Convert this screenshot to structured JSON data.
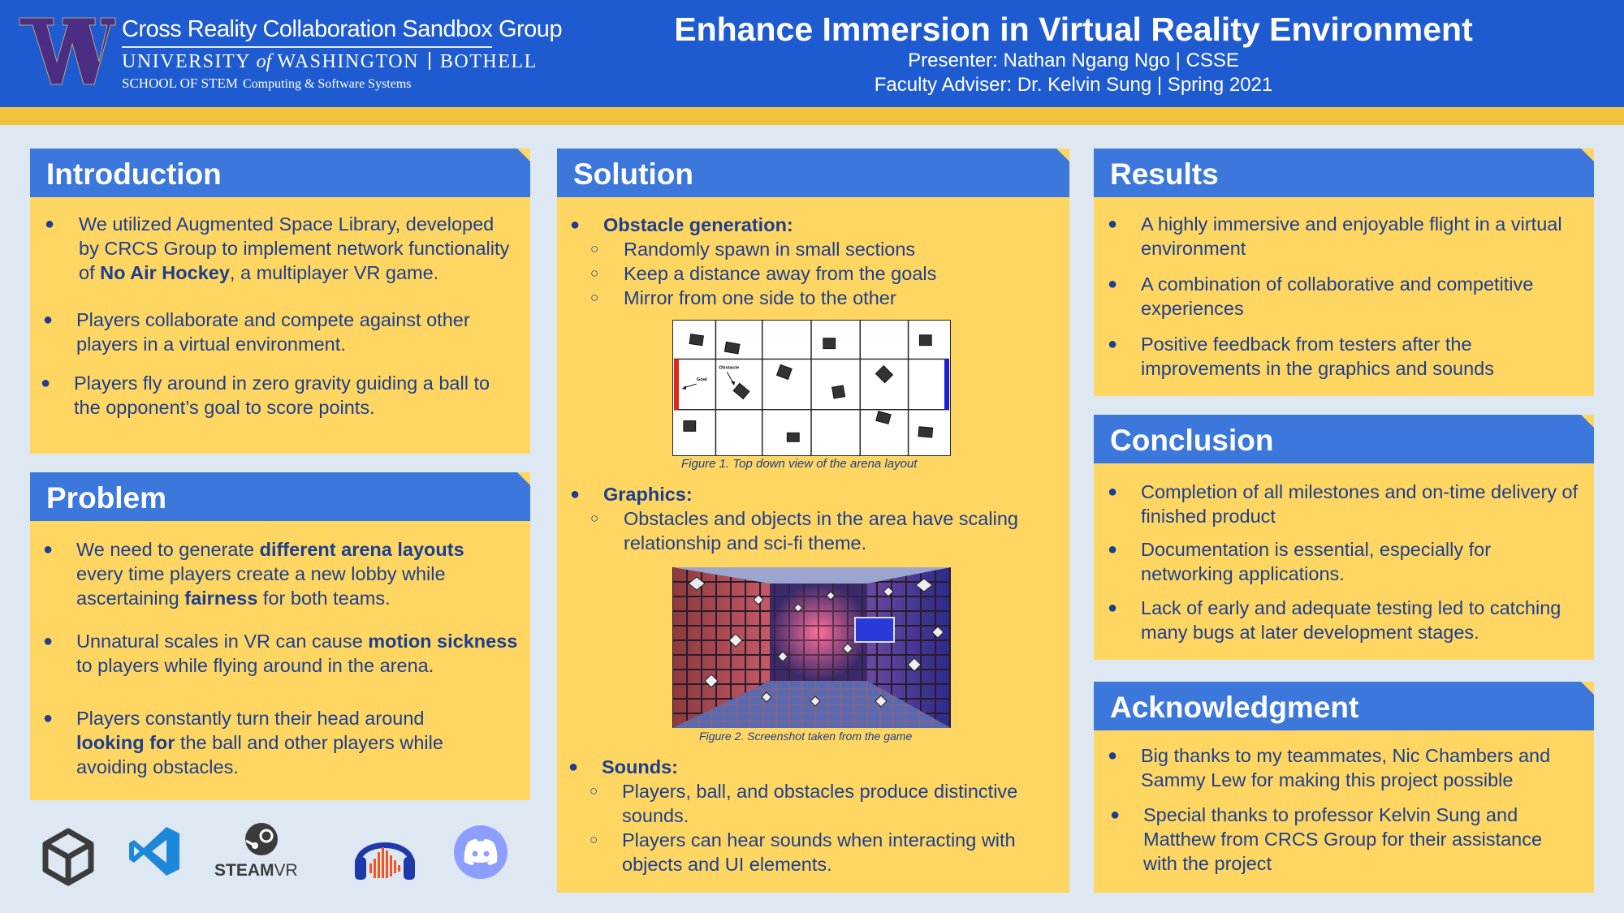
{
  "header": {
    "logo_line1": "Cross Reality Collaboration Sandbox Group",
    "logo_line2_a": "UNIVERSITY",
    "logo_line2_of": "of",
    "logo_line2_b": "WASHINGTON",
    "logo_line2_c": "BOTHELL",
    "logo_line3_a": "SCHOOL OF STEM",
    "logo_line3_b": "Computing & Software Systems",
    "title": "Enhance Immersion in Virtual Reality Environment",
    "presenter": "Presenter: Nathan Ngang Ngo | CSSE",
    "adviser": "Faculty Adviser: Dr. Kelvin Sung | Spring 2021"
  },
  "introduction": {
    "title": "Introduction",
    "items": [
      {
        "before": "We utilized Augmented Space Library, developed by CRCS Group to implement network functionality of ",
        "bold": "No Air Hockey",
        "after": ", a multiplayer VR game."
      },
      {
        "text": "Players collaborate and compete against other players in a virtual environment."
      },
      {
        "text": "Players fly around in zero gravity guiding a ball to the opponent’s goal to score points."
      }
    ]
  },
  "problem": {
    "title": "Problem",
    "items": [
      {
        "a": "We need to generate ",
        "b": "different arena layouts",
        "c": " every time players create a new lobby while ascertaining ",
        "d": "fairness",
        "e": " for both teams."
      },
      {
        "a": "Unnatural scales in VR can cause ",
        "b": "motion sickness",
        "c": " to players while flying around in the arena."
      },
      {
        "a": "Players constantly turn their head around ",
        "b": "looking for",
        "c": " the ball and other players while avoiding obstacles."
      }
    ]
  },
  "solution": {
    "title": "Solution",
    "obstacle_heading": "Obstacle generation:",
    "obstacle_items": [
      "Randomly spawn in small sections",
      "Keep a distance away from the goals",
      "Mirror from one side to the other"
    ],
    "figure1_caption": "Figure 1. Top down view of the arena layout",
    "figure1_goal_label": "Goal",
    "figure1_obstacle_label": "Obstacle",
    "graphics_heading": "Graphics:",
    "graphics_items": [
      "Obstacles and objects in the area have scaling relationship and sci-fi theme."
    ],
    "figure2_caption": "Figure 2. Screenshot taken from the game",
    "sounds_heading": "Sounds:",
    "sounds_items": [
      "Players, ball, and obstacles produce distinctive sounds.",
      "Players can hear sounds when interacting with objects and UI elements."
    ]
  },
  "results": {
    "title": "Results",
    "items": [
      "A highly immersive and enjoyable flight in a virtual environment",
      "A combination of collaborative and competitive experiences",
      "Positive feedback from testers after the improvements in the graphics and sounds"
    ]
  },
  "conclusion": {
    "title": "Conclusion",
    "items": [
      "Completion of all milestones and on-time delivery of finished product",
      "Documentation is essential, especially for networking applications.",
      "Lack of early and adequate testing led to catching many bugs at later development stages."
    ]
  },
  "acknowledgment": {
    "title": "Acknowledgment",
    "items": [
      "Big thanks to my teammates, Nic Chambers and Sammy Lew for making this project possible",
      "Special thanks to professor Kelvin Sung and Matthew from CRCS Group for their assistance with the project"
    ]
  },
  "footer": {
    "steam_label_a": "STEAM",
    "steam_label_b": "VR",
    "icons": [
      "unity-icon",
      "visual-studio-code-icon",
      "steamvr-icon",
      "audacity-icon",
      "discord-icon"
    ]
  },
  "colors": {
    "header_blue": "#1f5bd0",
    "gold": "#f0c33c",
    "panel_yellow": "#ffd662",
    "panel_head_blue": "#3c77dc",
    "text_navy": "#1c3f8f",
    "uw_purple": "#4b2e83"
  }
}
